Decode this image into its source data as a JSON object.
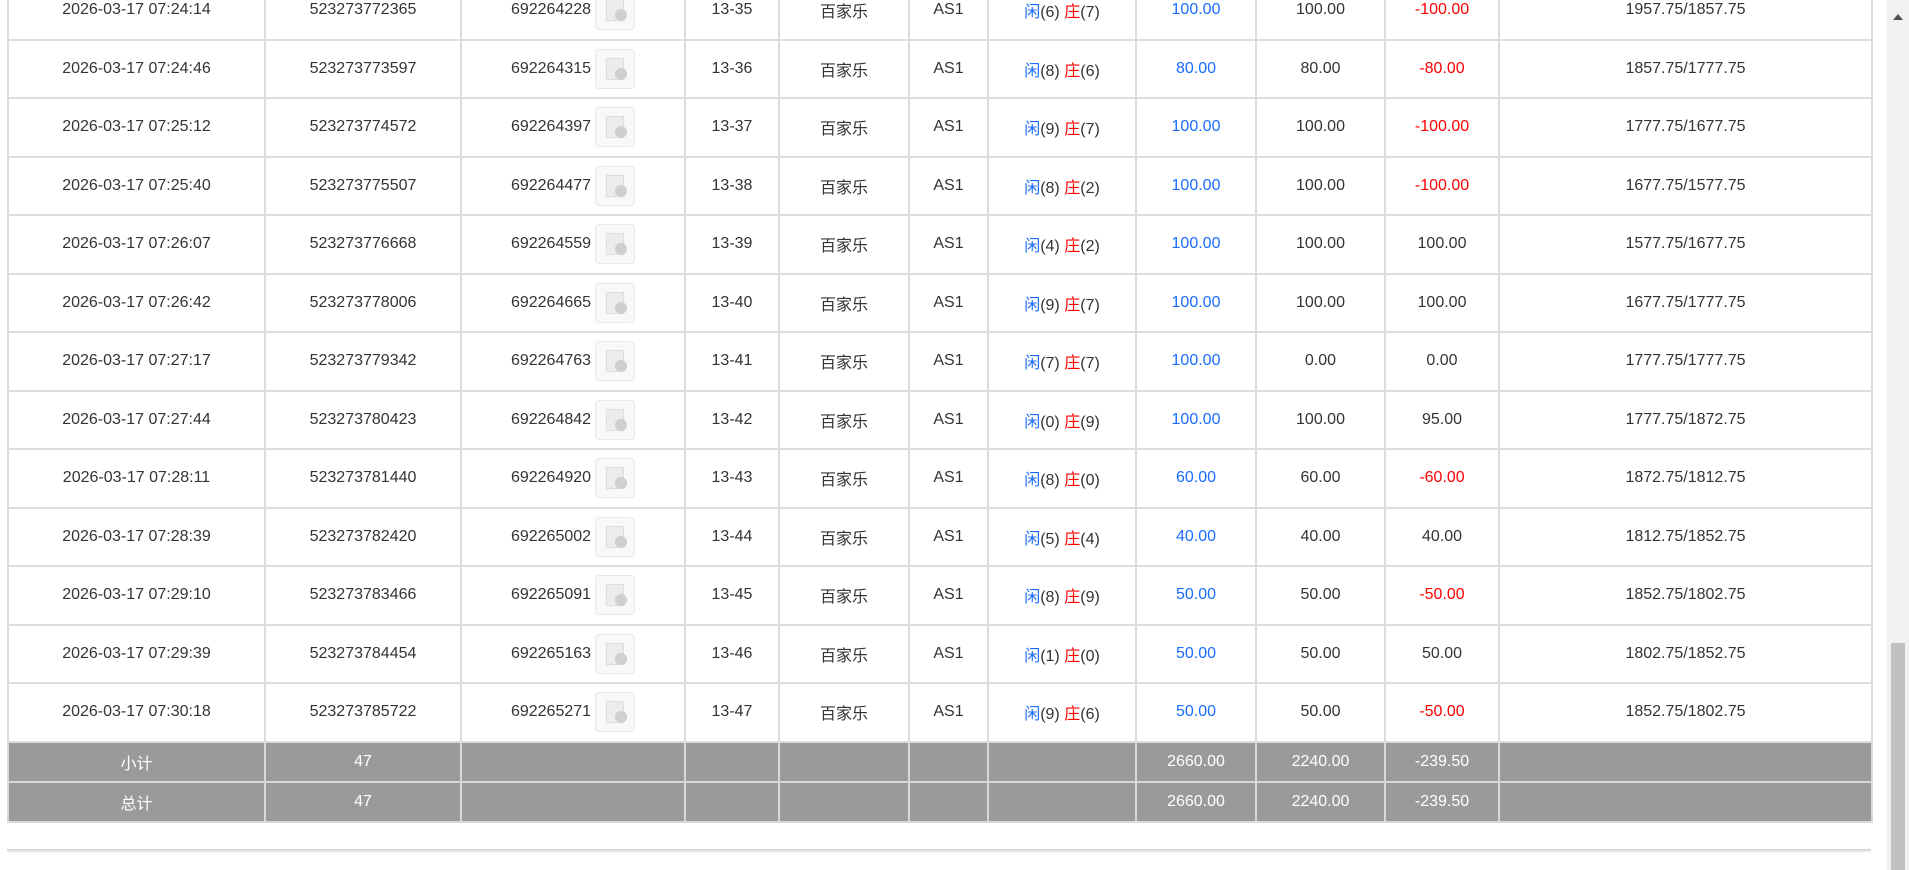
{
  "rows": [
    {
      "time": "2026-03-17 07:24:14",
      "bet_id": "523273772365",
      "game_no": "692264228",
      "shoe": "13-35",
      "game": "百家乐",
      "table": "AS1",
      "player_label": "闲",
      "player": "(6)",
      "banker_label": "庄",
      "banker": "(7)",
      "bet": "100.00",
      "valid": "100.00",
      "winloss": "-100.00",
      "balance": "1957.75/1857.75"
    },
    {
      "time": "2026-03-17 07:24:46",
      "bet_id": "523273773597",
      "game_no": "692264315",
      "shoe": "13-36",
      "game": "百家乐",
      "table": "AS1",
      "player_label": "闲",
      "player": "(8)",
      "banker_label": "庄",
      "banker": "(6)",
      "bet": "80.00",
      "valid": "80.00",
      "winloss": "-80.00",
      "balance": "1857.75/1777.75"
    },
    {
      "time": "2026-03-17 07:25:12",
      "bet_id": "523273774572",
      "game_no": "692264397",
      "shoe": "13-37",
      "game": "百家乐",
      "table": "AS1",
      "player_label": "闲",
      "player": "(9)",
      "banker_label": "庄",
      "banker": "(7)",
      "bet": "100.00",
      "valid": "100.00",
      "winloss": "-100.00",
      "balance": "1777.75/1677.75"
    },
    {
      "time": "2026-03-17 07:25:40",
      "bet_id": "523273775507",
      "game_no": "692264477",
      "shoe": "13-38",
      "game": "百家乐",
      "table": "AS1",
      "player_label": "闲",
      "player": "(8)",
      "banker_label": "庄",
      "banker": "(2)",
      "bet": "100.00",
      "valid": "100.00",
      "winloss": "-100.00",
      "balance": "1677.75/1577.75"
    },
    {
      "time": "2026-03-17 07:26:07",
      "bet_id": "523273776668",
      "game_no": "692264559",
      "shoe": "13-39",
      "game": "百家乐",
      "table": "AS1",
      "player_label": "闲",
      "player": "(4)",
      "banker_label": "庄",
      "banker": "(2)",
      "bet": "100.00",
      "valid": "100.00",
      "winloss": "100.00",
      "balance": "1577.75/1677.75"
    },
    {
      "time": "2026-03-17 07:26:42",
      "bet_id": "523273778006",
      "game_no": "692264665",
      "shoe": "13-40",
      "game": "百家乐",
      "table": "AS1",
      "player_label": "闲",
      "player": "(9)",
      "banker_label": "庄",
      "banker": "(7)",
      "bet": "100.00",
      "valid": "100.00",
      "winloss": "100.00",
      "balance": "1677.75/1777.75"
    },
    {
      "time": "2026-03-17 07:27:17",
      "bet_id": "523273779342",
      "game_no": "692264763",
      "shoe": "13-41",
      "game": "百家乐",
      "table": "AS1",
      "player_label": "闲",
      "player": "(7)",
      "banker_label": "庄",
      "banker": "(7)",
      "bet": "100.00",
      "valid": "0.00",
      "winloss": "0.00",
      "balance": "1777.75/1777.75"
    },
    {
      "time": "2026-03-17 07:27:44",
      "bet_id": "523273780423",
      "game_no": "692264842",
      "shoe": "13-42",
      "game": "百家乐",
      "table": "AS1",
      "player_label": "闲",
      "player": "(0)",
      "banker_label": "庄",
      "banker": "(9)",
      "bet": "100.00",
      "valid": "100.00",
      "winloss": "95.00",
      "balance": "1777.75/1872.75"
    },
    {
      "time": "2026-03-17 07:28:11",
      "bet_id": "523273781440",
      "game_no": "692264920",
      "shoe": "13-43",
      "game": "百家乐",
      "table": "AS1",
      "player_label": "闲",
      "player": "(8)",
      "banker_label": "庄",
      "banker": "(0)",
      "bet": "60.00",
      "valid": "60.00",
      "winloss": "-60.00",
      "balance": "1872.75/1812.75"
    },
    {
      "time": "2026-03-17 07:28:39",
      "bet_id": "523273782420",
      "game_no": "692265002",
      "shoe": "13-44",
      "game": "百家乐",
      "table": "AS1",
      "player_label": "闲",
      "player": "(5)",
      "banker_label": "庄",
      "banker": "(4)",
      "bet": "40.00",
      "valid": "40.00",
      "winloss": "40.00",
      "balance": "1812.75/1852.75"
    },
    {
      "time": "2026-03-17 07:29:10",
      "bet_id": "523273783466",
      "game_no": "692265091",
      "shoe": "13-45",
      "game": "百家乐",
      "table": "AS1",
      "player_label": "闲",
      "player": "(8)",
      "banker_label": "庄",
      "banker": "(9)",
      "bet": "50.00",
      "valid": "50.00",
      "winloss": "-50.00",
      "balance": "1852.75/1802.75"
    },
    {
      "time": "2026-03-17 07:29:39",
      "bet_id": "523273784454",
      "game_no": "692265163",
      "shoe": "13-46",
      "game": "百家乐",
      "table": "AS1",
      "player_label": "闲",
      "player": "(1)",
      "banker_label": "庄",
      "banker": "(0)",
      "bet": "50.00",
      "valid": "50.00",
      "winloss": "50.00",
      "balance": "1802.75/1852.75"
    },
    {
      "time": "2026-03-17 07:30:18",
      "bet_id": "523273785722",
      "game_no": "692265271",
      "shoe": "13-47",
      "game": "百家乐",
      "table": "AS1",
      "player_label": "闲",
      "player": "(9)",
      "banker_label": "庄",
      "banker": "(6)",
      "bet": "50.00",
      "valid": "50.00",
      "winloss": "-50.00",
      "balance": "1852.75/1802.75"
    }
  ],
  "subtotal": {
    "label": "小计",
    "count": "47",
    "bet": "2660.00",
    "valid": "2240.00",
    "winloss": "-239.50"
  },
  "total": {
    "label": "总计",
    "count": "47",
    "bet": "2660.00",
    "valid": "2240.00",
    "winloss": "-239.50"
  },
  "icons": {
    "replay": "video-replay-icon"
  },
  "colors": {
    "player": "#1a6cff",
    "banker": "#ff0000",
    "negative": "#ff0000",
    "summary_bg": "#9a9a9a"
  }
}
